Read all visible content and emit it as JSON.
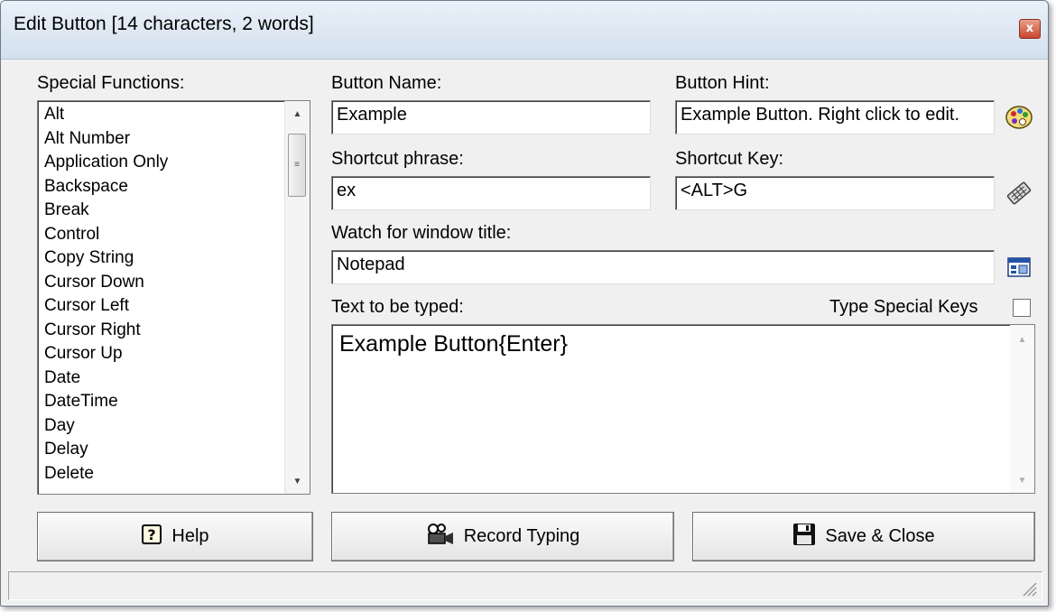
{
  "window": {
    "title": "Edit Button [14 characters, 2 words]",
    "close_glyph": "x"
  },
  "special_functions": {
    "label": "Special Functions:",
    "items": [
      "Alt",
      "Alt Number",
      "Application Only",
      "Backspace",
      "Break",
      "Control",
      "Copy String",
      "Cursor Down",
      "Cursor Left",
      "Cursor Right",
      "Cursor Up",
      "Date",
      "DateTime",
      "Day",
      "Delay",
      "Delete"
    ]
  },
  "fields": {
    "button_name": {
      "label": "Button Name:",
      "value": "Example"
    },
    "button_hint": {
      "label": "Button Hint:",
      "value": "Example Button. Right click to edit."
    },
    "shortcut_phrase": {
      "label": "Shortcut phrase:",
      "value": "ex"
    },
    "shortcut_key": {
      "label": "Shortcut Key:",
      "value": "<ALT>G"
    },
    "window_title": {
      "label": "Watch for window title:",
      "value": "Notepad"
    },
    "text_to_type": {
      "label": "Text to be typed:",
      "value": "Example Button{Enter}"
    }
  },
  "type_special_keys": {
    "label": "Type Special Keys",
    "checked": false
  },
  "buttons": {
    "help": "Help",
    "record": "Record Typing",
    "save": "Save & Close"
  },
  "icons": {
    "hint_color": "palette-icon",
    "shortcut_key": "keyboard-icon",
    "window_picker": "window-icon",
    "help": "help-icon",
    "record": "camera-icon",
    "save": "floppy-disk-icon"
  }
}
